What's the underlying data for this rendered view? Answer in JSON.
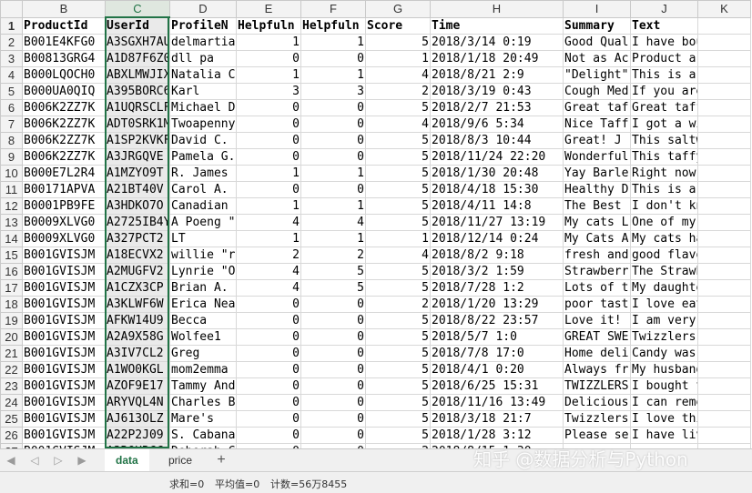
{
  "columns": [
    "B",
    "C",
    "D",
    "E",
    "F",
    "G",
    "H",
    "I",
    "J",
    "K"
  ],
  "selected_column": "C",
  "row_numbers": [
    "1",
    "2",
    "3",
    "4",
    "5",
    "6",
    "7",
    "8",
    "9",
    "10",
    "11",
    "12",
    "13",
    "14",
    "15",
    "16",
    "17",
    "18",
    "19",
    "20",
    "21",
    "22",
    "23",
    "24",
    "25",
    "26",
    "27"
  ],
  "headers": [
    "ProductId",
    "UserId",
    "ProfileN",
    "Helpfuln",
    "Helpfuln",
    "Score",
    "Time",
    "Summary",
    "Text",
    ""
  ],
  "rows": [
    [
      "B001E4KFG0",
      "A3SGXH7AU",
      "delmartia",
      "1",
      "1",
      "5",
      "2018/3/14 0:19",
      "Good Qual",
      "I have bought sev",
      ""
    ],
    [
      "B00813GRG4",
      "A1D87F6Z0",
      "dll pa",
      "0",
      "0",
      "1",
      "2018/1/18 20:49",
      "Not as Ac",
      "Product arrived l",
      ""
    ],
    [
      "B000LQOCH0",
      "ABXLMWJIX",
      "Natalia C",
      "1",
      "1",
      "4",
      "2018/8/21 2:9",
      "\"Delight\"",
      "This is a confect",
      ""
    ],
    [
      "B000UA0QIQ",
      "A395BORC6",
      "Karl",
      "3",
      "3",
      "2",
      "2018/3/19 0:43",
      "Cough Med",
      "If you are lookin",
      ""
    ],
    [
      "B006K2ZZ7K",
      "A1UQRSCLF",
      "Michael D",
      "0",
      "0",
      "5",
      "2018/2/7 21:53",
      "Great taf",
      "Great taffy at a",
      ""
    ],
    [
      "B006K2ZZ7K",
      "ADT0SRK1M",
      "Twoapenny",
      "0",
      "0",
      "4",
      "2018/9/6 5:34",
      "Nice Taff",
      "I got a wild hair",
      ""
    ],
    [
      "B006K2ZZ7K",
      "A1SP2KVKF",
      "David C.",
      "0",
      "0",
      "5",
      "2018/8/3 10:44",
      "Great!  J",
      "This saltwater ta",
      ""
    ],
    [
      "B006K2ZZ7K",
      "A3JRGQVE",
      "Pamela G.",
      "0",
      "0",
      "5",
      "2018/11/24 22:20",
      "Wonderful",
      "This taffy is so",
      ""
    ],
    [
      "B000E7L2R4",
      "A1MZYO9T",
      "R. James",
      "1",
      "1",
      "5",
      "2018/1/30 20:48",
      "Yay Barle",
      "Right now I'm mos",
      ""
    ],
    [
      "B00171APVA",
      "A21BT40V",
      "Carol A.",
      "0",
      "0",
      "5",
      "2018/4/18 15:30",
      "Healthy D",
      "This is a very he",
      ""
    ],
    [
      "B0001PB9FE",
      "A3HDKO7O",
      "Canadian",
      "1",
      "1",
      "5",
      "2018/4/11 14:8",
      "The Best",
      "I don't know if i",
      ""
    ],
    [
      "B0009XLVG0",
      "A2725IB4Y",
      "A Poeng \"",
      "4",
      "4",
      "5",
      "2018/11/27 13:19",
      "My cats L",
      "One of my boys ne",
      ""
    ],
    [
      "B0009XLVG0",
      "A327PCT2",
      "LT",
      "1",
      "1",
      "1",
      "2018/12/14 0:24",
      "My Cats A",
      "My cats have been",
      ""
    ],
    [
      "B001GVISJM",
      "A18ECVX2",
      "willie \"r",
      "2",
      "2",
      "4",
      "2018/8/2 9:18",
      "fresh and",
      "good flavor! thes",
      ""
    ],
    [
      "B001GVISJM",
      "A2MUGFV2",
      "Lynrie \"O",
      "4",
      "5",
      "5",
      "2018/3/2 1:59",
      "Strawberr",
      "The Strawberry Tw",
      ""
    ],
    [
      "B001GVISJM",
      "A1CZX3CP",
      "Brian A.",
      "4",
      "5",
      "5",
      "2018/7/28 1:2",
      "Lots of t",
      "My daughter loves",
      ""
    ],
    [
      "B001GVISJM",
      "A3KLWF6W",
      "Erica Nea",
      "0",
      "0",
      "2",
      "2018/1/20 13:29",
      "poor tast",
      "I love eating the",
      ""
    ],
    [
      "B001GVISJM",
      "AFKW14U9",
      "Becca",
      "0",
      "0",
      "5",
      "2018/8/22 23:57",
      "Love it!",
      "I am very satisfi",
      ""
    ],
    [
      "B001GVISJM",
      "A2A9X58G",
      "Wolfee1",
      "0",
      "0",
      "5",
      "2018/5/7 1:0",
      "GREAT SWE",
      "Twizzlers, Strawb",
      ""
    ],
    [
      "B001GVISJM",
      "A3IV7CL2",
      "Greg",
      "0",
      "0",
      "5",
      "2018/7/8 17:0",
      "Home deli",
      "Candy was deliver",
      ""
    ],
    [
      "B001GVISJM",
      "A1WO0KGL",
      "mom2emma",
      "0",
      "0",
      "5",
      "2018/4/1 0:20",
      "Always fr",
      "My husband is a T",
      ""
    ],
    [
      "B001GVISJM",
      "AZOF9E17",
      "Tammy And",
      "0",
      "0",
      "5",
      "2018/6/25 15:31",
      "TWIZZLERS",
      "I bought these fo",
      ""
    ],
    [
      "B001GVISJM",
      "ARYVQL4N",
      "Charles B",
      "0",
      "0",
      "5",
      "2018/11/16 13:49",
      "Delicious",
      "I can remember bu",
      ""
    ],
    [
      "B001GVISJM",
      "AJ613OLZ",
      "Mare's",
      "0",
      "0",
      "5",
      "2018/3/18 21:7",
      "Twizzlers",
      "I love this candy",
      ""
    ],
    [
      "B001GVISJM",
      "A22P2J09",
      "S. Cabana",
      "0",
      "0",
      "5",
      "2018/1/28 3:12",
      "Please se",
      "I have lived out",
      ""
    ],
    [
      "B001GVISJM",
      "A3ROHRGC",
      "Deborah C",
      "0",
      "0",
      "2",
      "2018/8/15 1:30",
      "",
      "",
      "",
      ""
    ]
  ],
  "sheet_tabs": [
    "data",
    "price"
  ],
  "active_tab": "data",
  "add_sheet_label": "+",
  "nav_arrows": [
    "◀",
    "◁",
    "▷",
    "▶"
  ],
  "watermark": "知乎 @数据分析与Python",
  "status": {
    "sum": "求和=0",
    "avg": "平均值=0",
    "count": "计数=56万8455"
  },
  "colors": {
    "accent": "#217346",
    "header_bg": "#f3f3f3",
    "selected_col_bg": "#eaeaea"
  }
}
